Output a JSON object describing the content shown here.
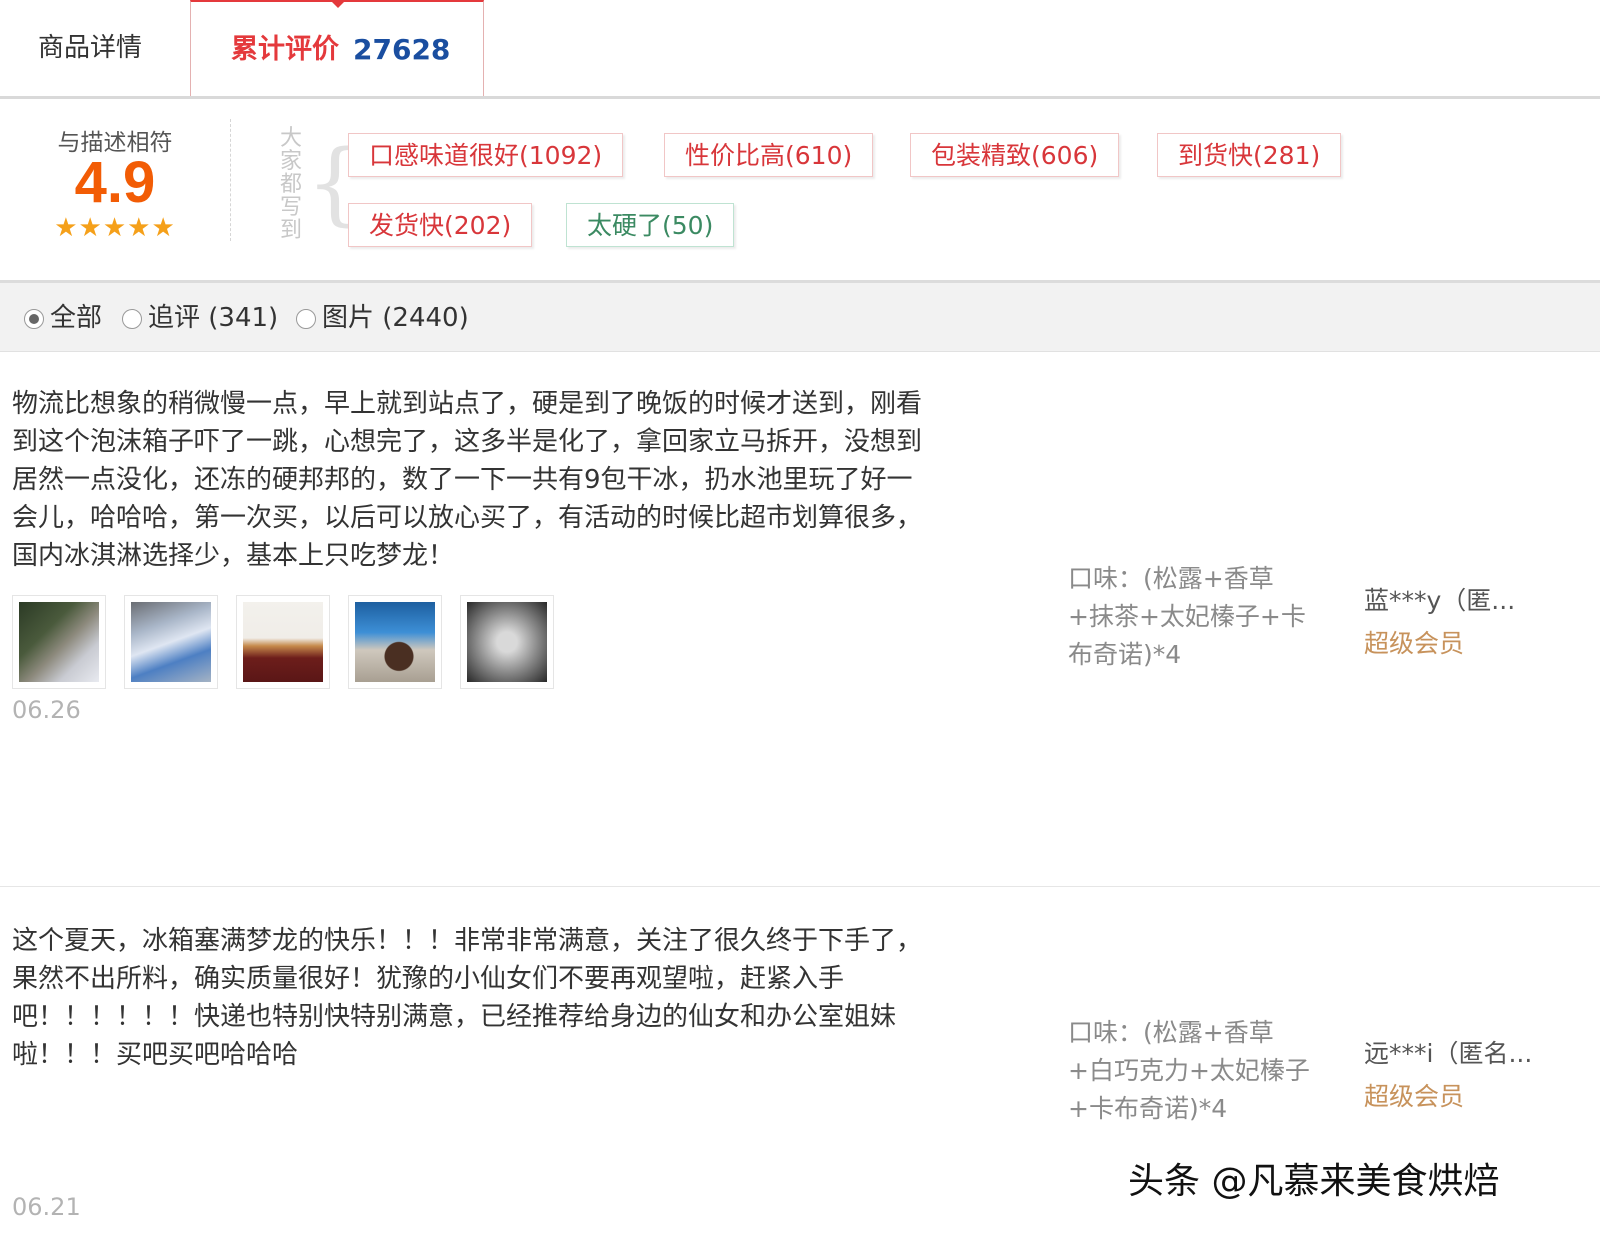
{
  "tabs": {
    "detail_label": "商品详情",
    "reviews_label": "累计评价",
    "reviews_count": "27628"
  },
  "rating": {
    "label": "与描述相符",
    "score": "4.9",
    "stars": "★★★★★"
  },
  "tags": {
    "heading": "大家都写到",
    "items": [
      {
        "label": "口感味道很好(1092)",
        "sentiment": "positive"
      },
      {
        "label": "性价比高(610)",
        "sentiment": "positive"
      },
      {
        "label": "包装精致(606)",
        "sentiment": "positive"
      },
      {
        "label": "到货快(281)",
        "sentiment": "positive"
      },
      {
        "label": "发货快(202)",
        "sentiment": "positive"
      },
      {
        "label": "太硬了(50)",
        "sentiment": "negative"
      }
    ]
  },
  "filters": {
    "options": [
      {
        "label": "全部",
        "selected": true
      },
      {
        "label": "追评 (341)",
        "selected": false
      },
      {
        "label": "图片 (2440)",
        "selected": false
      }
    ]
  },
  "reviews": [
    {
      "lines": [
        "物流比想象的稍微慢一点，早上就到站点了，硬是到了晚饭的时候才送到，刚看",
        "到这个泡沫箱子吓了一跳，心想完了，这多半是化了，拿回家立马拆开，没想到",
        "居然一点没化，还冻的硬邦邦的，数了一下一共有9包干冰，扔水池里玩了好一",
        "会儿，哈哈哈，第一次买，以后可以放心买了，有活动的时候比超市划算很多，",
        "国内冰淇淋选择少，基本上只吃梦龙！"
      ],
      "photo_count": 5,
      "date": "06.26",
      "sku_lines": [
        "口味：(松露+香草",
        "+抹茶+太妃榛子+卡",
        "布奇诺)*4"
      ],
      "user": "蓝***y（匿...",
      "member_level": "超级会员"
    },
    {
      "lines": [
        "这个夏天，冰箱塞满梦龙的快乐！！！非常非常满意，关注了很久终于下手了，",
        "果然不出所料，确实质量很好！犹豫的小仙女们不要再观望啦，赶紧入手",
        "吧！！！！！！快递也特别快特别满意，已经推荐给身边的仙女和办公室姐妹",
        "啦！！！买吧买吧哈哈哈"
      ],
      "date": "06.21",
      "sku_lines": [
        "口味：(松露+香草",
        "+白巧克力+太妃榛子",
        "+卡布奇诺)*4"
      ],
      "user": "远***i（匿名...",
      "member_level": "超级会员"
    }
  ],
  "watermark": "头条 @凡慕来美食烘焙",
  "colors": {
    "accent_red": "#e4393c",
    "count_blue": "#1a4ea0",
    "score_orange": "#f25c05",
    "star_gold": "#f5a01a",
    "member_gold": "#c7925b"
  }
}
